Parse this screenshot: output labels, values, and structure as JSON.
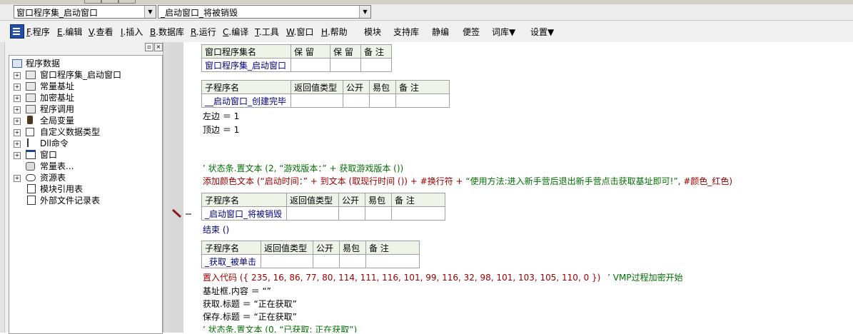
{
  "combos": {
    "program_set": "窗口程序集_启动窗口",
    "subroutine": "_启动窗口_将被销毁"
  },
  "menu": [
    {
      "acc": "F",
      "label": ".程序"
    },
    {
      "acc": "E",
      "label": ".编辑"
    },
    {
      "acc": "V",
      "label": ".查看"
    },
    {
      "acc": "I",
      "label": ".插入"
    },
    {
      "acc": "B",
      "label": ".数据库"
    },
    {
      "acc": "R",
      "label": ".运行"
    },
    {
      "acc": "C",
      "label": ".编译"
    },
    {
      "acc": "T",
      "label": ".工具"
    },
    {
      "acc": "W",
      "label": ".窗口"
    },
    {
      "acc": "H",
      "label": ".帮助"
    },
    {
      "acc": "",
      "label": "模块"
    },
    {
      "acc": "",
      "label": "支持库"
    },
    {
      "acc": "",
      "label": "静编"
    },
    {
      "acc": "",
      "label": "便签"
    },
    {
      "acc": "",
      "label": "词库▼"
    },
    {
      "acc": "",
      "label": "设置▼"
    }
  ],
  "tree": {
    "root": "程序数据",
    "items": [
      {
        "label": "窗口程序集_启动窗口",
        "icon": "book-stack-icon"
      },
      {
        "label": "常量基址",
        "icon": "book-stack-icon"
      },
      {
        "label": "加密基址",
        "icon": "book-stack-icon"
      },
      {
        "label": "程序调用",
        "icon": "book-stack-icon"
      },
      {
        "label": "全局变量",
        "icon": "barrel-icon"
      },
      {
        "label": "自定义数据类型",
        "icon": "struct-icon"
      },
      {
        "label": "Dll命令",
        "icon": "dll-icon"
      },
      {
        "label": "窗口",
        "icon": "window-icon"
      },
      {
        "label": "常量表...",
        "icon": "db-icon"
      },
      {
        "label": "资源表",
        "icon": "resource-icon"
      },
      {
        "label": "模块引用表",
        "icon": "module-icon"
      },
      {
        "label": "外部文件记录表",
        "icon": "file-icon"
      }
    ]
  },
  "editor": {
    "set_table": {
      "headers": [
        "窗口程序集名",
        "保 留",
        "保 留",
        "备 注"
      ],
      "values": [
        "窗口程序集_启动窗口",
        "",
        "",
        ""
      ]
    },
    "sub1": {
      "headers": [
        "子程序名",
        "返回值类型",
        "公开",
        "易包",
        "备 注"
      ],
      "values": [
        "__启动窗口_创建完毕",
        "",
        "",
        "",
        ""
      ]
    },
    "line_left": "左边 ＝ 1",
    "line_top": "顶边 ＝ 1",
    "comment1": "’ 状态条.置文本 (2, “游戏版本：” + 获取游戏版本 ())",
    "line_addcolor_a": "添加颜色文本 (“启动时间：” + 到文本 (取现行时间 ()) + #换行符 + ",
    "line_addcolor_b": "“使用方法:进入新手营后退出新手营点击获取基址即可!”",
    "line_addcolor_c": ", #颜色_红色)",
    "sub2": {
      "headers": [
        "子程序名",
        "返回值类型",
        "公开",
        "易包",
        "备 注"
      ],
      "values": [
        "_启动窗口_将被销毁",
        "",
        "",
        "",
        ""
      ]
    },
    "line_end": "结束 ()",
    "sub3": {
      "headers": [
        "子程序名",
        "返回值类型",
        "公开",
        "易包",
        "备 注"
      ],
      "values": [
        "_获取_被单击",
        "",
        "",
        "",
        ""
      ]
    },
    "line_embed_a": "置入代码 ({ 235, 16, 86, 77, 80, 114, 111, 116, 101, 99, 116, 32, 98, 101, 103, 105, 110, 0 })",
    "line_embed_b": "’ VMP过程加密开始",
    "line_content": "基址框.内容 ＝ “”",
    "line_get_title": "获取.标题 ＝ “正在获取”",
    "line_save_title": "保存.标题 ＝ “正在获取”",
    "comment2": "’ 状态条.置文本 (0, “已获取: 正在获取”)"
  }
}
